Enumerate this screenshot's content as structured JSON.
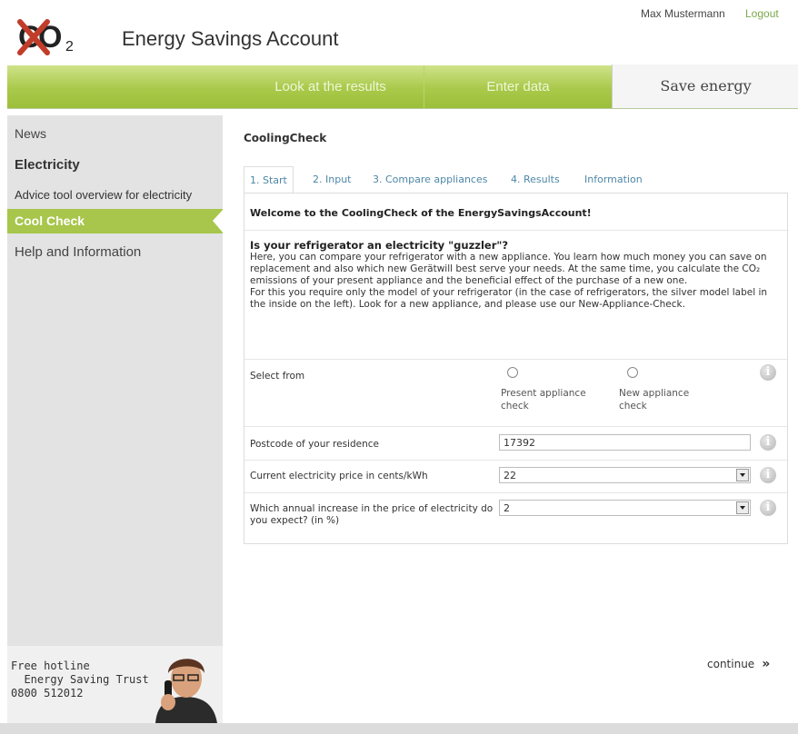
{
  "header": {
    "logo_alt": "CO2",
    "app_title": "Energy Savings Account",
    "user_name": "Max Mustermann",
    "logout_label": "Logout"
  },
  "topnav": {
    "tabs": [
      "Look at the results",
      "Enter data",
      "Save energy"
    ],
    "active": "Save energy"
  },
  "sidebar": {
    "items": [
      "News",
      "Electricity",
      "Advice tool overview for electricity",
      "Cool Check",
      "Help and Information"
    ],
    "active": "Cool Check",
    "hotline": "Free hotline\n  Energy Saving Trust\n0800 512012"
  },
  "main": {
    "title": "CoolingCheck",
    "tabs": [
      "1. Start",
      "2. Input",
      "3. Compare appliances",
      "4. Results",
      "Information"
    ],
    "active_tab": "1. Start",
    "welcome": "Welcome to the CoolingCheck of the EnergySavingsAccount!",
    "intro_head": "Is your refrigerator an electricity \"guzzler\"?",
    "intro_text": "Here, you can compare your refrigerator with a new appliance. You learn how much money you can save on replacement and also which new Gerätwill best serve your needs. At the same time, you calculate the CO₂ emissions of your present appliance and the beneficial effect of the purchase of a new one.\nFor this you require only the model of your refrigerator (in the case of refrigerators, the silver model label in the inside on the left). Look for a new appliance, and please use our New-Appliance-Check.",
    "select_label": "Select from",
    "option_present": "Present appliance check",
    "option_new": "New appliance check",
    "postcode_label": "Postcode of your residence",
    "postcode_value": "17392",
    "price_label": "Current electricity price in cents/kWh",
    "price_value": "22",
    "increase_label": "Which annual increase in the price of electricity do you expect? (in %)",
    "increase_value": "2",
    "continue_label": "continue",
    "continue_glyph": "»"
  },
  "colors": {
    "accent_green": "#a7c64b",
    "link_blue": "#4d87a6",
    "sidebar_bg": "#e3e3e3"
  }
}
